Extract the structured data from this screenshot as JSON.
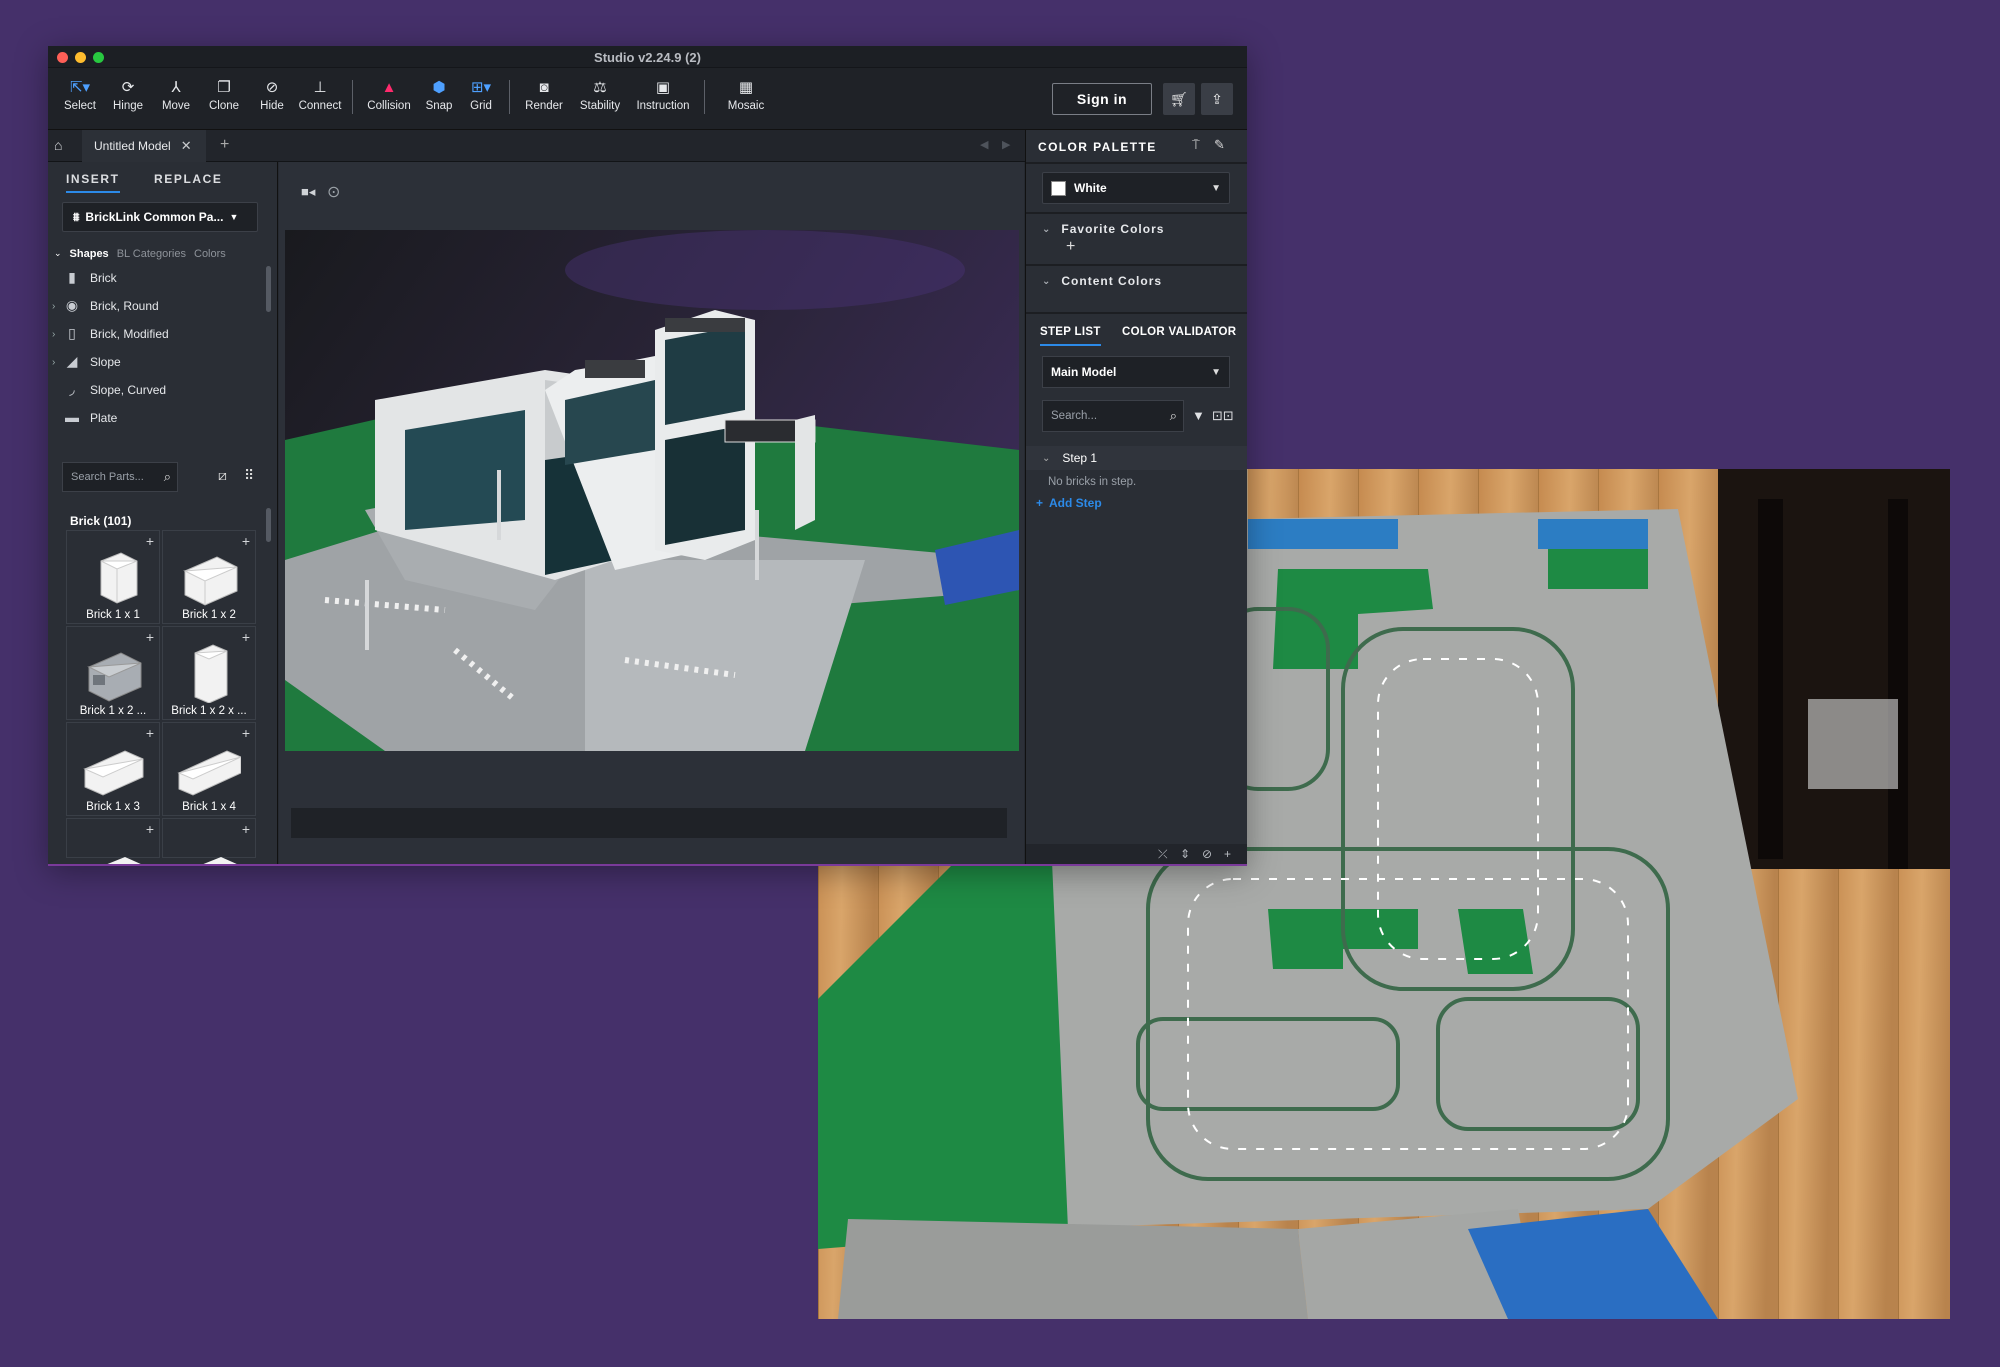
{
  "window": {
    "title": "Studio v2.24.9 (2)"
  },
  "toolbar": {
    "tools": [
      {
        "label": "Select",
        "icon": "select-icon"
      },
      {
        "label": "Hinge",
        "icon": "hinge-icon"
      },
      {
        "label": "Move",
        "icon": "move-icon"
      },
      {
        "label": "Clone",
        "icon": "clone-icon"
      },
      {
        "label": "Hide",
        "icon": "hide-icon"
      },
      {
        "label": "Connect",
        "icon": "connect-icon"
      },
      {
        "label": "Collision",
        "icon": "collision-icon"
      },
      {
        "label": "Snap",
        "icon": "snap-icon"
      },
      {
        "label": "Grid",
        "icon": "grid-icon"
      },
      {
        "label": "Render",
        "icon": "camera-icon"
      },
      {
        "label": "Stability",
        "icon": "stability-icon"
      },
      {
        "label": "Instruction",
        "icon": "instruction-icon"
      },
      {
        "label": "Mosaic",
        "icon": "mosaic-icon"
      }
    ],
    "sign_in": "Sign in"
  },
  "tabs": {
    "document": "Untitled Model"
  },
  "left_panel": {
    "tab_insert": "INSERT",
    "tab_replace": "REPLACE",
    "category_dropdown": "BrickLink Common Pa...",
    "shape_tabs": [
      "Shapes",
      "BL Categories",
      "Colors"
    ],
    "shapes": [
      "Brick",
      "Brick, Round",
      "Brick, Modified",
      "Slope",
      "Slope, Curved",
      "Plate"
    ],
    "search_placeholder": "Search Parts...",
    "brick_group": "Brick (101)",
    "parts": [
      "Brick 1 x 1",
      "Brick 1 x 2",
      "Brick 1 x 2 ...",
      "Brick 1 x 2 x ...",
      "Brick 1 x 3",
      "Brick 1 x 4"
    ]
  },
  "right_panel": {
    "color_palette": "COLOR PALETTE",
    "selected_color": "White",
    "favorite_colors": "Favorite Colors",
    "content_colors": "Content Colors",
    "tab_step_list": "STEP LIST",
    "tab_color_validator": "COLOR VALIDATOR",
    "model_dropdown": "Main Model",
    "search_placeholder": "Search...",
    "step_label": "Step 1",
    "empty_step": "No bricks in step.",
    "add_step": "Add Step"
  },
  "colors": {
    "accent": "#2c8ae8",
    "background": "#45306a",
    "panel": "#2a2e35"
  }
}
